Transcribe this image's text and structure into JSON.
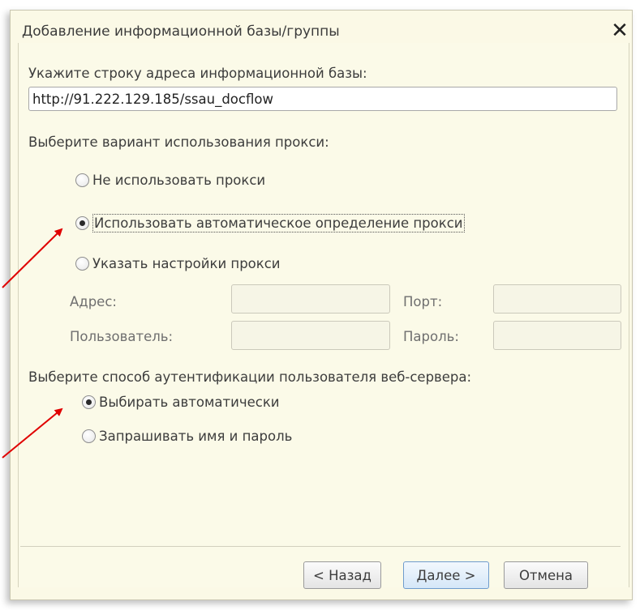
{
  "window": {
    "title": "Добавление информационной базы/группы",
    "close_symbol": "✕"
  },
  "address_section": {
    "label": "Укажите строку адреса информационной базы:",
    "value": "http://91.222.129.185/ssau_docflow"
  },
  "proxy_section": {
    "label": "Выберите вариант использования прокси:",
    "options": [
      {
        "label": "Не использовать прокси",
        "checked": false
      },
      {
        "label": "Использовать автоматическое определение прокси",
        "checked": true
      },
      {
        "label": "Указать настройки прокси",
        "checked": false
      }
    ],
    "fields": {
      "address_label": "Адрес:",
      "port_label": "Порт:",
      "user_label": "Пользователь:",
      "password_label": "Пароль:",
      "address_value": "",
      "port_value": "",
      "user_value": "",
      "password_value": ""
    }
  },
  "auth_section": {
    "label": "Выберите способ аутентификации пользователя веб-сервера:",
    "options": [
      {
        "label": "Выбирать автоматически",
        "checked": true
      },
      {
        "label": "Запрашивать имя и пароль",
        "checked": false
      }
    ]
  },
  "buttons": {
    "back": "< Назад",
    "next": "Далее >",
    "cancel": "Отмена"
  },
  "colors": {
    "dialog_bg": "#fbf9e6",
    "annotation_arrow": "#e00000",
    "primary_button_border": "#6f9ccd"
  }
}
